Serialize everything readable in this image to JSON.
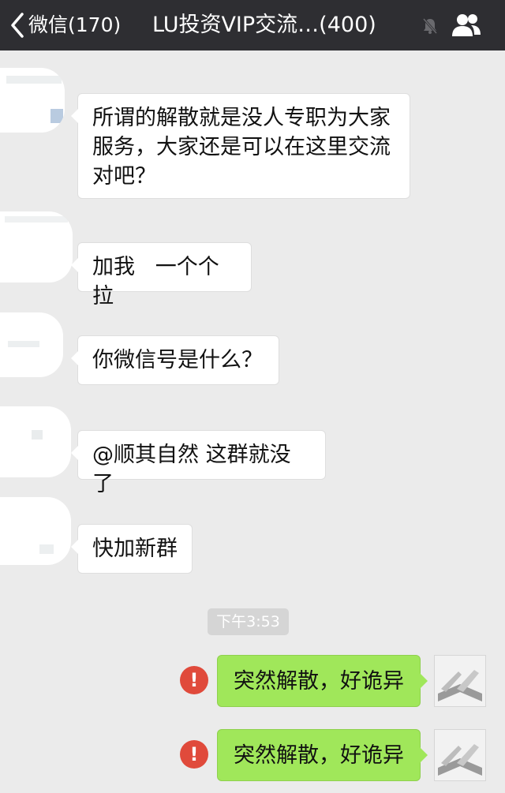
{
  "header": {
    "back_label": "微信(170)",
    "title": "LU投资VIP交流…(400)",
    "mute_icon": "bell-mute-icon",
    "members_icon": "group-members-icon",
    "bar_color": "#2e2e32"
  },
  "messages": [
    {
      "text": "所谓的解散就是没人专职为大家\n服务，大家还是可以在这里交流\n对吧？"
    },
    {
      "text": "加我   一个个拉"
    },
    {
      "text": "你微信号是什么？"
    },
    {
      "text": "@顺其自然 这群就没了"
    },
    {
      "text": "快加新群"
    }
  ],
  "timestamp": "下午3:53",
  "sent": [
    {
      "text": "突然解散，好诡异",
      "status_icon": "error-icon",
      "status_glyph": "!"
    },
    {
      "text": "突然解散，好诡异",
      "status_icon": "error-icon",
      "status_glyph": "!"
    }
  ],
  "colors": {
    "chat_background": "#ebebeb",
    "incoming_bubble": "#ffffff",
    "outgoing_bubble": "#a0e75a",
    "error": "#e04a3b"
  }
}
